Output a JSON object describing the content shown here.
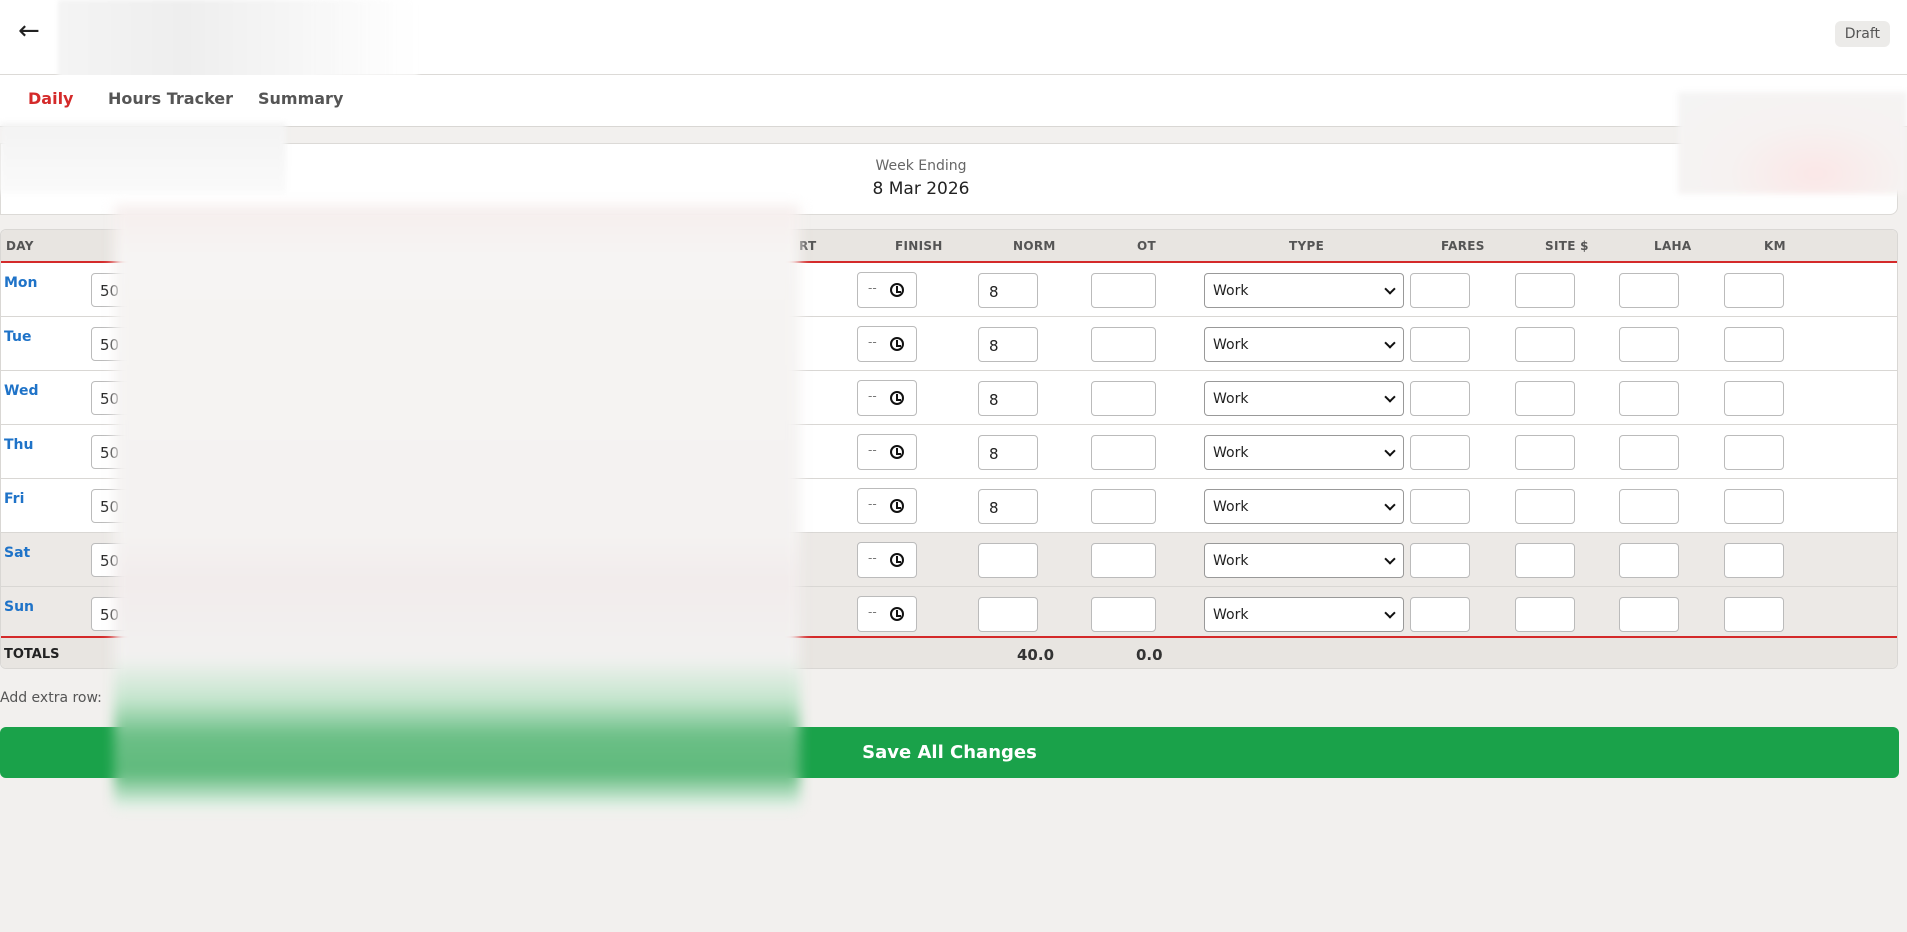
{
  "header": {
    "back_icon": "arrow-left-icon",
    "status_badge": "Draft"
  },
  "tabs": [
    {
      "label": "Daily",
      "active": true
    },
    {
      "label": "Hours Tracker",
      "active": false
    },
    {
      "label": "Summary",
      "active": false
    }
  ],
  "week": {
    "label": "Week Ending",
    "date": "8 Mar 2026"
  },
  "table": {
    "columns": {
      "day": "DAY",
      "start_partial": "RT",
      "finish": "FINISH",
      "norm": "NORM",
      "ot": "OT",
      "type": "TYPE",
      "fares": "FARES",
      "site": "SITE $",
      "laha": "LAHA",
      "km": "KM"
    },
    "rows": [
      {
        "day": "Mon",
        "start_partial": "50",
        "finish": "--",
        "norm": "8",
        "ot": "",
        "type": "Work",
        "fares": "",
        "site": "",
        "laha": "",
        "km": ""
      },
      {
        "day": "Tue",
        "start_partial": "50",
        "finish": "--",
        "norm": "8",
        "ot": "",
        "type": "Work",
        "fares": "",
        "site": "",
        "laha": "",
        "km": ""
      },
      {
        "day": "Wed",
        "start_partial": "50",
        "finish": "--",
        "norm": "8",
        "ot": "",
        "type": "Work",
        "fares": "",
        "site": "",
        "laha": "",
        "km": ""
      },
      {
        "day": "Thu",
        "start_partial": "50",
        "finish": "--",
        "norm": "8",
        "ot": "",
        "type": "Work",
        "fares": "",
        "site": "",
        "laha": "",
        "km": ""
      },
      {
        "day": "Fri",
        "start_partial": "50",
        "finish": "--",
        "norm": "8",
        "ot": "",
        "type": "Work",
        "fares": "",
        "site": "",
        "laha": "",
        "km": ""
      },
      {
        "day": "Sat",
        "start_partial": "50",
        "finish": "--",
        "norm": "",
        "ot": "",
        "type": "Work",
        "fares": "",
        "site": "",
        "laha": "",
        "km": ""
      },
      {
        "day": "Sun",
        "start_partial": "50",
        "finish": "--",
        "norm": "",
        "ot": "",
        "type": "Work",
        "fares": "",
        "site": "",
        "laha": "",
        "km": ""
      }
    ],
    "totals": {
      "label": "TOTALS",
      "norm": "40.0",
      "ot": "0.0"
    }
  },
  "extra_row_label": "Add extra row:",
  "save_label": "Save All Changes",
  "colors": {
    "accent_red": "#d42a2a",
    "save_green": "#1aa24a",
    "day_blue": "#1f73c8"
  }
}
